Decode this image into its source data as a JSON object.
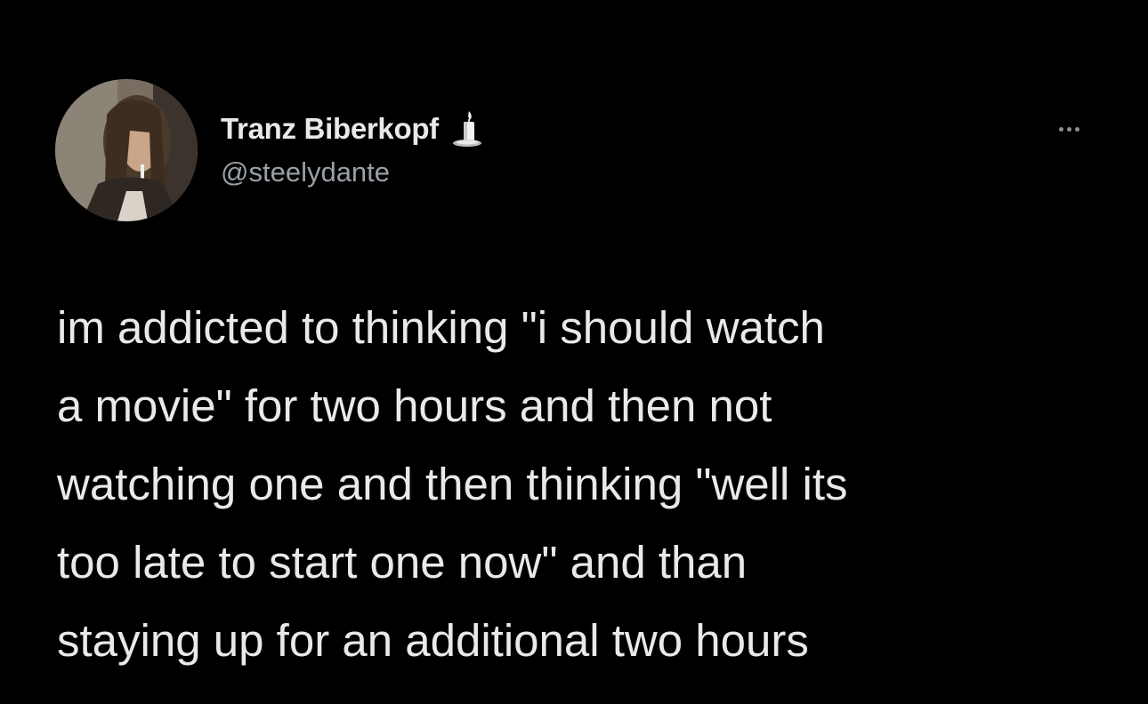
{
  "tweet": {
    "author": {
      "display_name": "Tranz Biberkopf",
      "handle": "@steelydante",
      "name_emoji_icon": "candle-icon",
      "avatar_icon": "profile-photo"
    },
    "more_icon": "ellipsis-icon",
    "text_lines": [
      "im addicted to thinking \"i should watch",
      "a movie\" for two hours and then not",
      "watching one and then thinking \"well its",
      "too late to start one now\" and than",
      "staying up for an additional two hours"
    ]
  },
  "colors": {
    "background": "#000000",
    "primary_text": "#e7e9ea",
    "secondary_text": "#9aa0a6"
  }
}
